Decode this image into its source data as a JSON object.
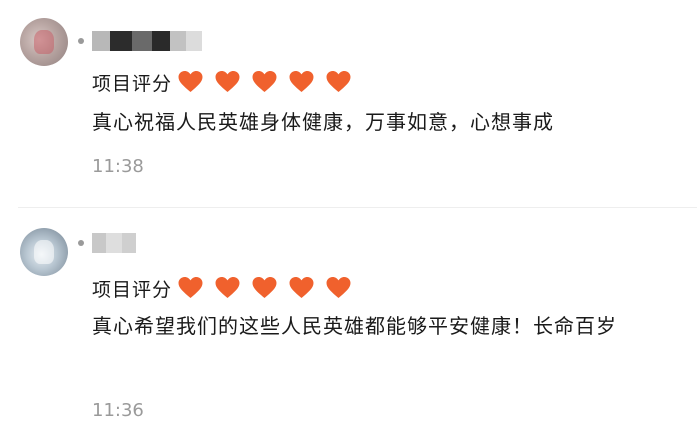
{
  "colors": {
    "heart": "#f0612d",
    "text": "#1a1a1a",
    "time": "#9a9a9a"
  },
  "comments": [
    {
      "rating_label": "项目评分",
      "rating_hearts": 5,
      "text": "真心祝福人民英雄身体健康，万事如意，心想事成",
      "time": "11:38"
    },
    {
      "rating_label": "项目评分",
      "rating_hearts": 5,
      "text": "真心希望我们的这些人民英雄都能够平安健康！长命百岁",
      "time": "11:36"
    }
  ]
}
